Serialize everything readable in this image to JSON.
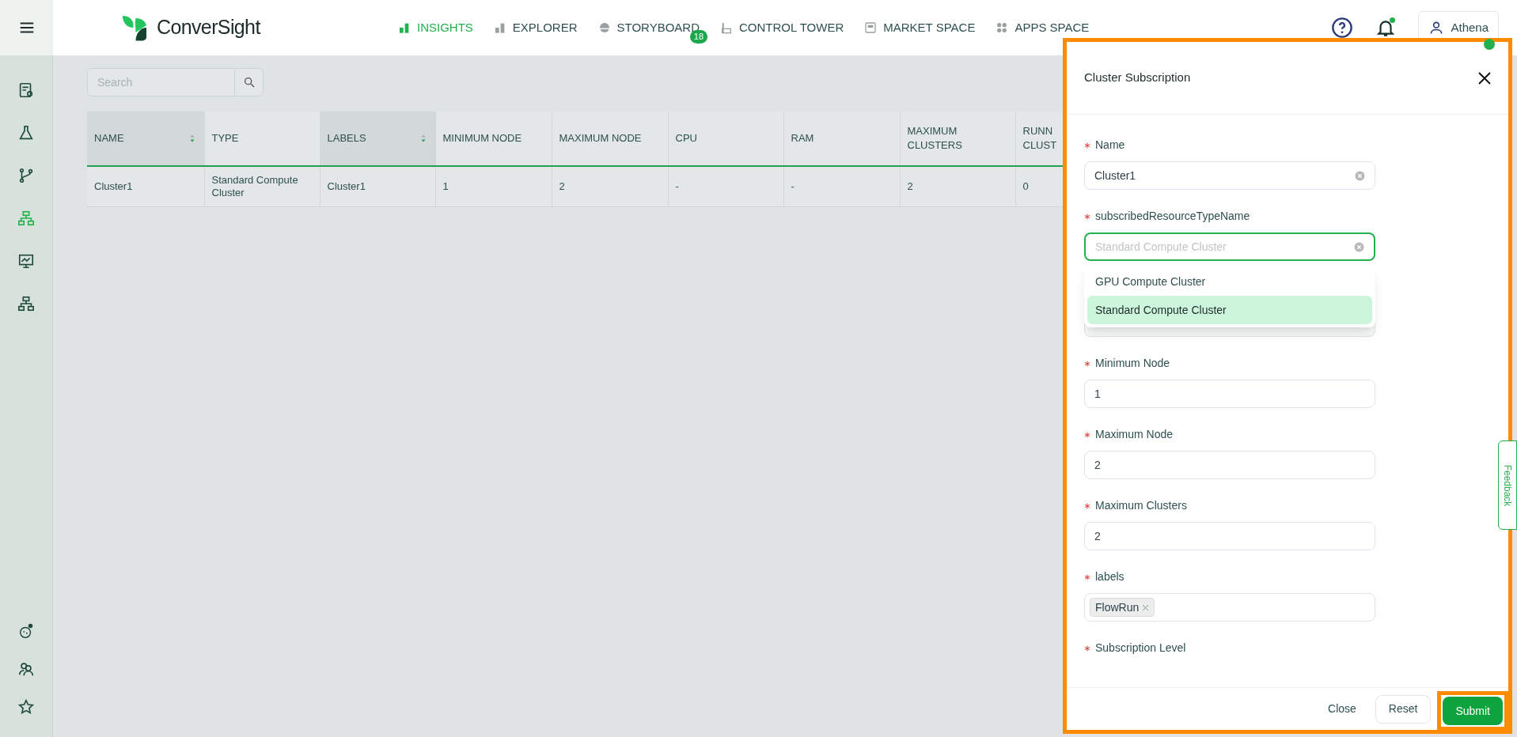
{
  "nav": {
    "logo": "ConverSight",
    "items": [
      {
        "label": "INSIGHTS",
        "selected": true,
        "kind": "bars"
      },
      {
        "label": "EXPLORER",
        "selected": false,
        "kind": "bars"
      },
      {
        "label": "STORYBOARD",
        "selected": false,
        "kind": "gauge",
        "badge": "18"
      },
      {
        "label": "CONTROL TOWER",
        "selected": false,
        "kind": "tower"
      },
      {
        "label": "MARKET SPACE",
        "selected": false,
        "kind": "store"
      },
      {
        "label": "APPS SPACE",
        "selected": false,
        "kind": "dots"
      }
    ]
  },
  "notifications": {
    "unread": true
  },
  "user": {
    "name": "Athena",
    "online": true
  },
  "sidebar": {
    "items": [
      {
        "kind": "report",
        "selected": false
      },
      {
        "kind": "flask",
        "selected": false
      },
      {
        "kind": "branch",
        "selected": false
      },
      {
        "kind": "hierarchy",
        "selected": true
      },
      {
        "kind": "presentation",
        "selected": false
      },
      {
        "kind": "hierarchy",
        "selected": false
      }
    ],
    "bottom_items": [
      {
        "kind": "bot"
      },
      {
        "kind": "users"
      },
      {
        "kind": "star"
      }
    ]
  },
  "search": {
    "placeholder": "Search"
  },
  "table": {
    "columns": [
      {
        "label": "NAME",
        "sortable": true
      },
      {
        "label": "TYPE",
        "sortable": false
      },
      {
        "label": "LABELS",
        "sortable": true
      },
      {
        "label": "MINIMUM NODE",
        "sortable": false
      },
      {
        "label": "MAXIMUM NODE",
        "sortable": false
      },
      {
        "label": "CPU",
        "sortable": false
      },
      {
        "label": "RAM",
        "sortable": false
      },
      {
        "label": "MAXIMUM CLUSTERS",
        "sortable": false
      },
      {
        "label": "RUNN CLUST",
        "sortable": false
      }
    ],
    "rows": [
      [
        "Cluster1",
        "Standard Compute Cluster",
        "Cluster1",
        "1",
        "2",
        "-",
        "-",
        "2",
        "0"
      ]
    ]
  },
  "drawer": {
    "title": "Cluster Subscription",
    "fields": [
      {
        "kind": "text",
        "label": "Name",
        "required": true,
        "value": "Cluster1",
        "clearable": true,
        "focused": false
      },
      {
        "kind": "select",
        "label": "subscribedResourceTypeName",
        "required": true,
        "placeholder": "Standard Compute Cluster",
        "clearable": true,
        "focused": true,
        "options": [
          {
            "label": "GPU Compute Cluster",
            "selected": false
          },
          {
            "label": "Standard Compute Cluster",
            "selected": true
          }
        ]
      },
      {
        "kind": "text",
        "label": "Minimum Node",
        "required": true,
        "value": "1",
        "clearable": false,
        "focused": false
      },
      {
        "kind": "text",
        "label": "Maximum Node",
        "required": true,
        "value": "2",
        "clearable": false,
        "focused": false
      },
      {
        "kind": "text",
        "label": "Maximum Clusters",
        "required": true,
        "value": "2",
        "clearable": false,
        "focused": false
      },
      {
        "kind": "tags",
        "label": "labels",
        "required": true,
        "tags": [
          "FlowRun"
        ],
        "focused": false
      },
      {
        "kind": "cut",
        "label": "Subscription Level",
        "required": true
      }
    ],
    "buttons": [
      {
        "label": "Close",
        "kind": "text",
        "highlighted": false
      },
      {
        "label": "Reset",
        "kind": "outline",
        "highlighted": false
      },
      {
        "label": "Submit",
        "kind": "primary",
        "highlighted": true
      }
    ]
  },
  "feedback_tab": {
    "label": "Feedback"
  }
}
